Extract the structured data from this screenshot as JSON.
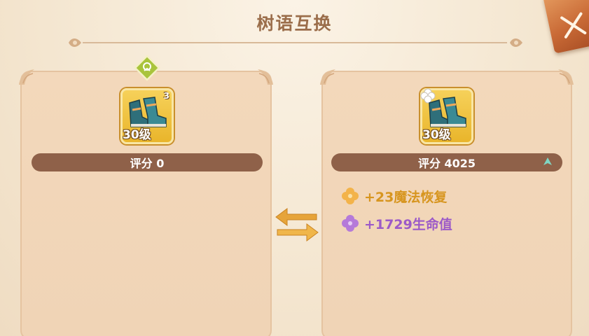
{
  "dialog": {
    "title": "树语互换"
  },
  "left_item": {
    "level": "30级",
    "count": "3",
    "score": "评分 0"
  },
  "right_item": {
    "level": "30级",
    "score": "评分 4025"
  },
  "attributes": [
    {
      "text": "+23魔法恢复",
      "color": "#d7951e"
    },
    {
      "text": "+1729生命值",
      "color": "#9c5ac8"
    }
  ],
  "icons": {
    "close": "close-icon",
    "swap": "swap-arrows-icon",
    "score_up": "arrow-up-icon",
    "badge": "diamond-badge-icon"
  }
}
